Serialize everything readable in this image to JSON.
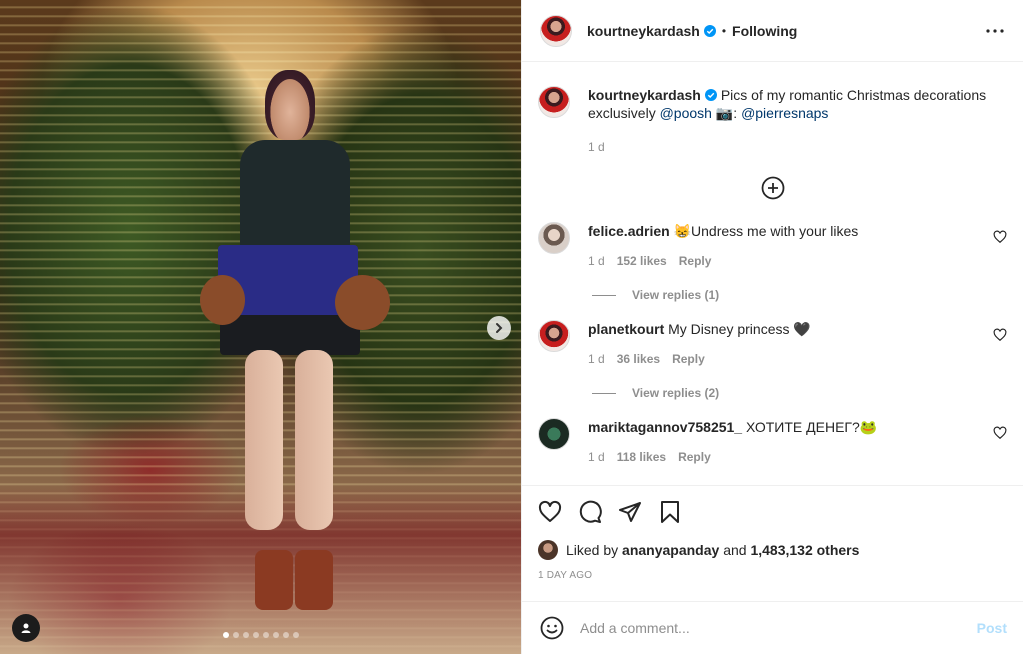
{
  "post": {
    "image_dots": 8,
    "image_dot_active": 0
  },
  "header": {
    "username": "kourtneykardash",
    "separator": "•",
    "follow_state": "Following"
  },
  "caption": {
    "username": "kourtneykardash",
    "text_before": "Pics of my romantic Christmas decorations exclusively ",
    "mention_1": "@poosh",
    "camera_emoji": "📷",
    "colon": ": ",
    "mention_2": "@pierresnaps",
    "time": "1 d"
  },
  "comments": [
    {
      "username": "felice.adrien",
      "text": "😸Undress me with your likes",
      "time": "1 d",
      "likes": "152 likes",
      "reply": "Reply",
      "view_replies": "View replies (1)"
    },
    {
      "username": "planetkourt",
      "text": "My Disney princess 🖤",
      "time": "1 d",
      "likes": "36 likes",
      "reply": "Reply",
      "view_replies": "View replies (2)"
    },
    {
      "username": "mariktagannov758251_",
      "text": "ХОТИТЕ ДЕНЕГ?🐸",
      "time": "1 d",
      "likes": "118 likes",
      "reply": "Reply"
    }
  ],
  "likes": {
    "prefix": "Liked by ",
    "user": "ananyapanday",
    "middle": " and ",
    "others": "1,483,132 others"
  },
  "date": "1 DAY AGO",
  "add_comment": {
    "placeholder": "Add a comment...",
    "post_label": "Post"
  },
  "icons": {
    "verified": "verified-badge-icon",
    "more": "more-options-icon",
    "add": "plus-circle-icon",
    "heart": "heart-icon",
    "comment": "comment-icon",
    "share": "share-icon",
    "save": "bookmark-icon",
    "emoji": "emoji-icon",
    "next": "chevron-right-icon",
    "user_tag": "user-tag-icon"
  },
  "colors": {
    "verified": "#0095f6",
    "link": "#00376b",
    "muted": "#8e8e8e",
    "post_disabled": "#b2dffc"
  }
}
